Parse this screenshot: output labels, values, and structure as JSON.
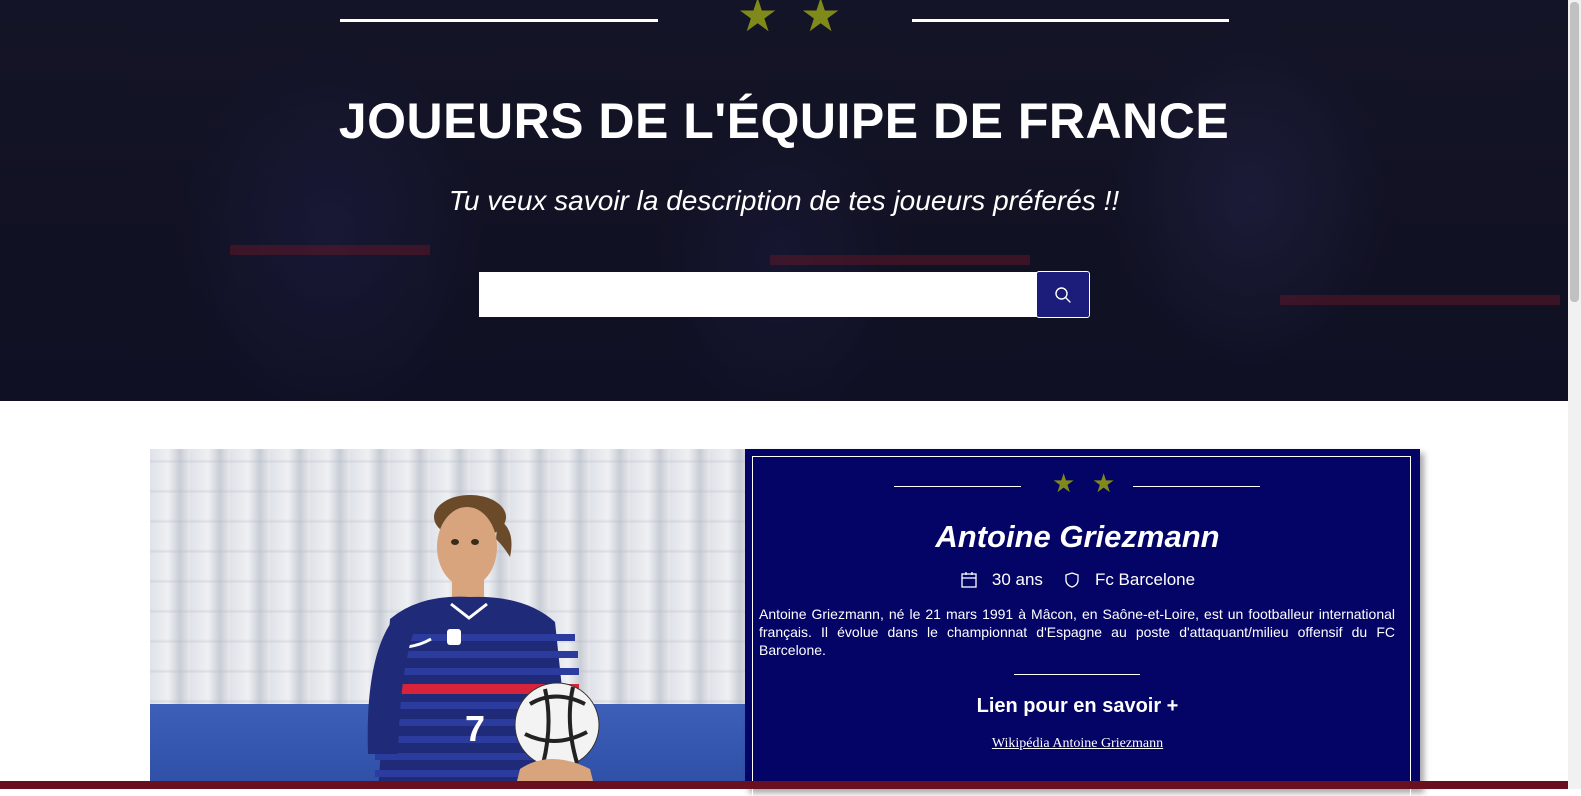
{
  "hero": {
    "title": "JOUEURS DE L'ÉQUIPE DE FRANCE",
    "subtitle": "Tu veux savoir la description de tes joueurs préferés !!",
    "stars": [
      "★",
      "★"
    ],
    "search": {
      "value": "",
      "placeholder": "",
      "button_icon": "search-icon"
    }
  },
  "player": {
    "name": "Antoine Griezmann",
    "stars": [
      "★",
      "★"
    ],
    "age": "30 ans",
    "age_icon": "calendar-icon",
    "club": "Fc Barcelone",
    "club_icon": "shield-icon",
    "bio": "Antoine Griezmann, né le 21 mars 1991 à Mâcon, en Saône-et-Loire, est un footballeur international français. Il évolue dans le championnat d'Espagne au poste d'attaquant/milieu offensif du FC Barcelone.",
    "more_heading": "Lien pour en savoir +",
    "wiki_link": "Wikipédia Antoine Griezmann",
    "jersey_number": "7"
  },
  "colors": {
    "navy": "#030465",
    "star_olive": "#7f8a1a",
    "search_button": "#1c1c7a",
    "hero_dark": "#1a1a2e"
  }
}
